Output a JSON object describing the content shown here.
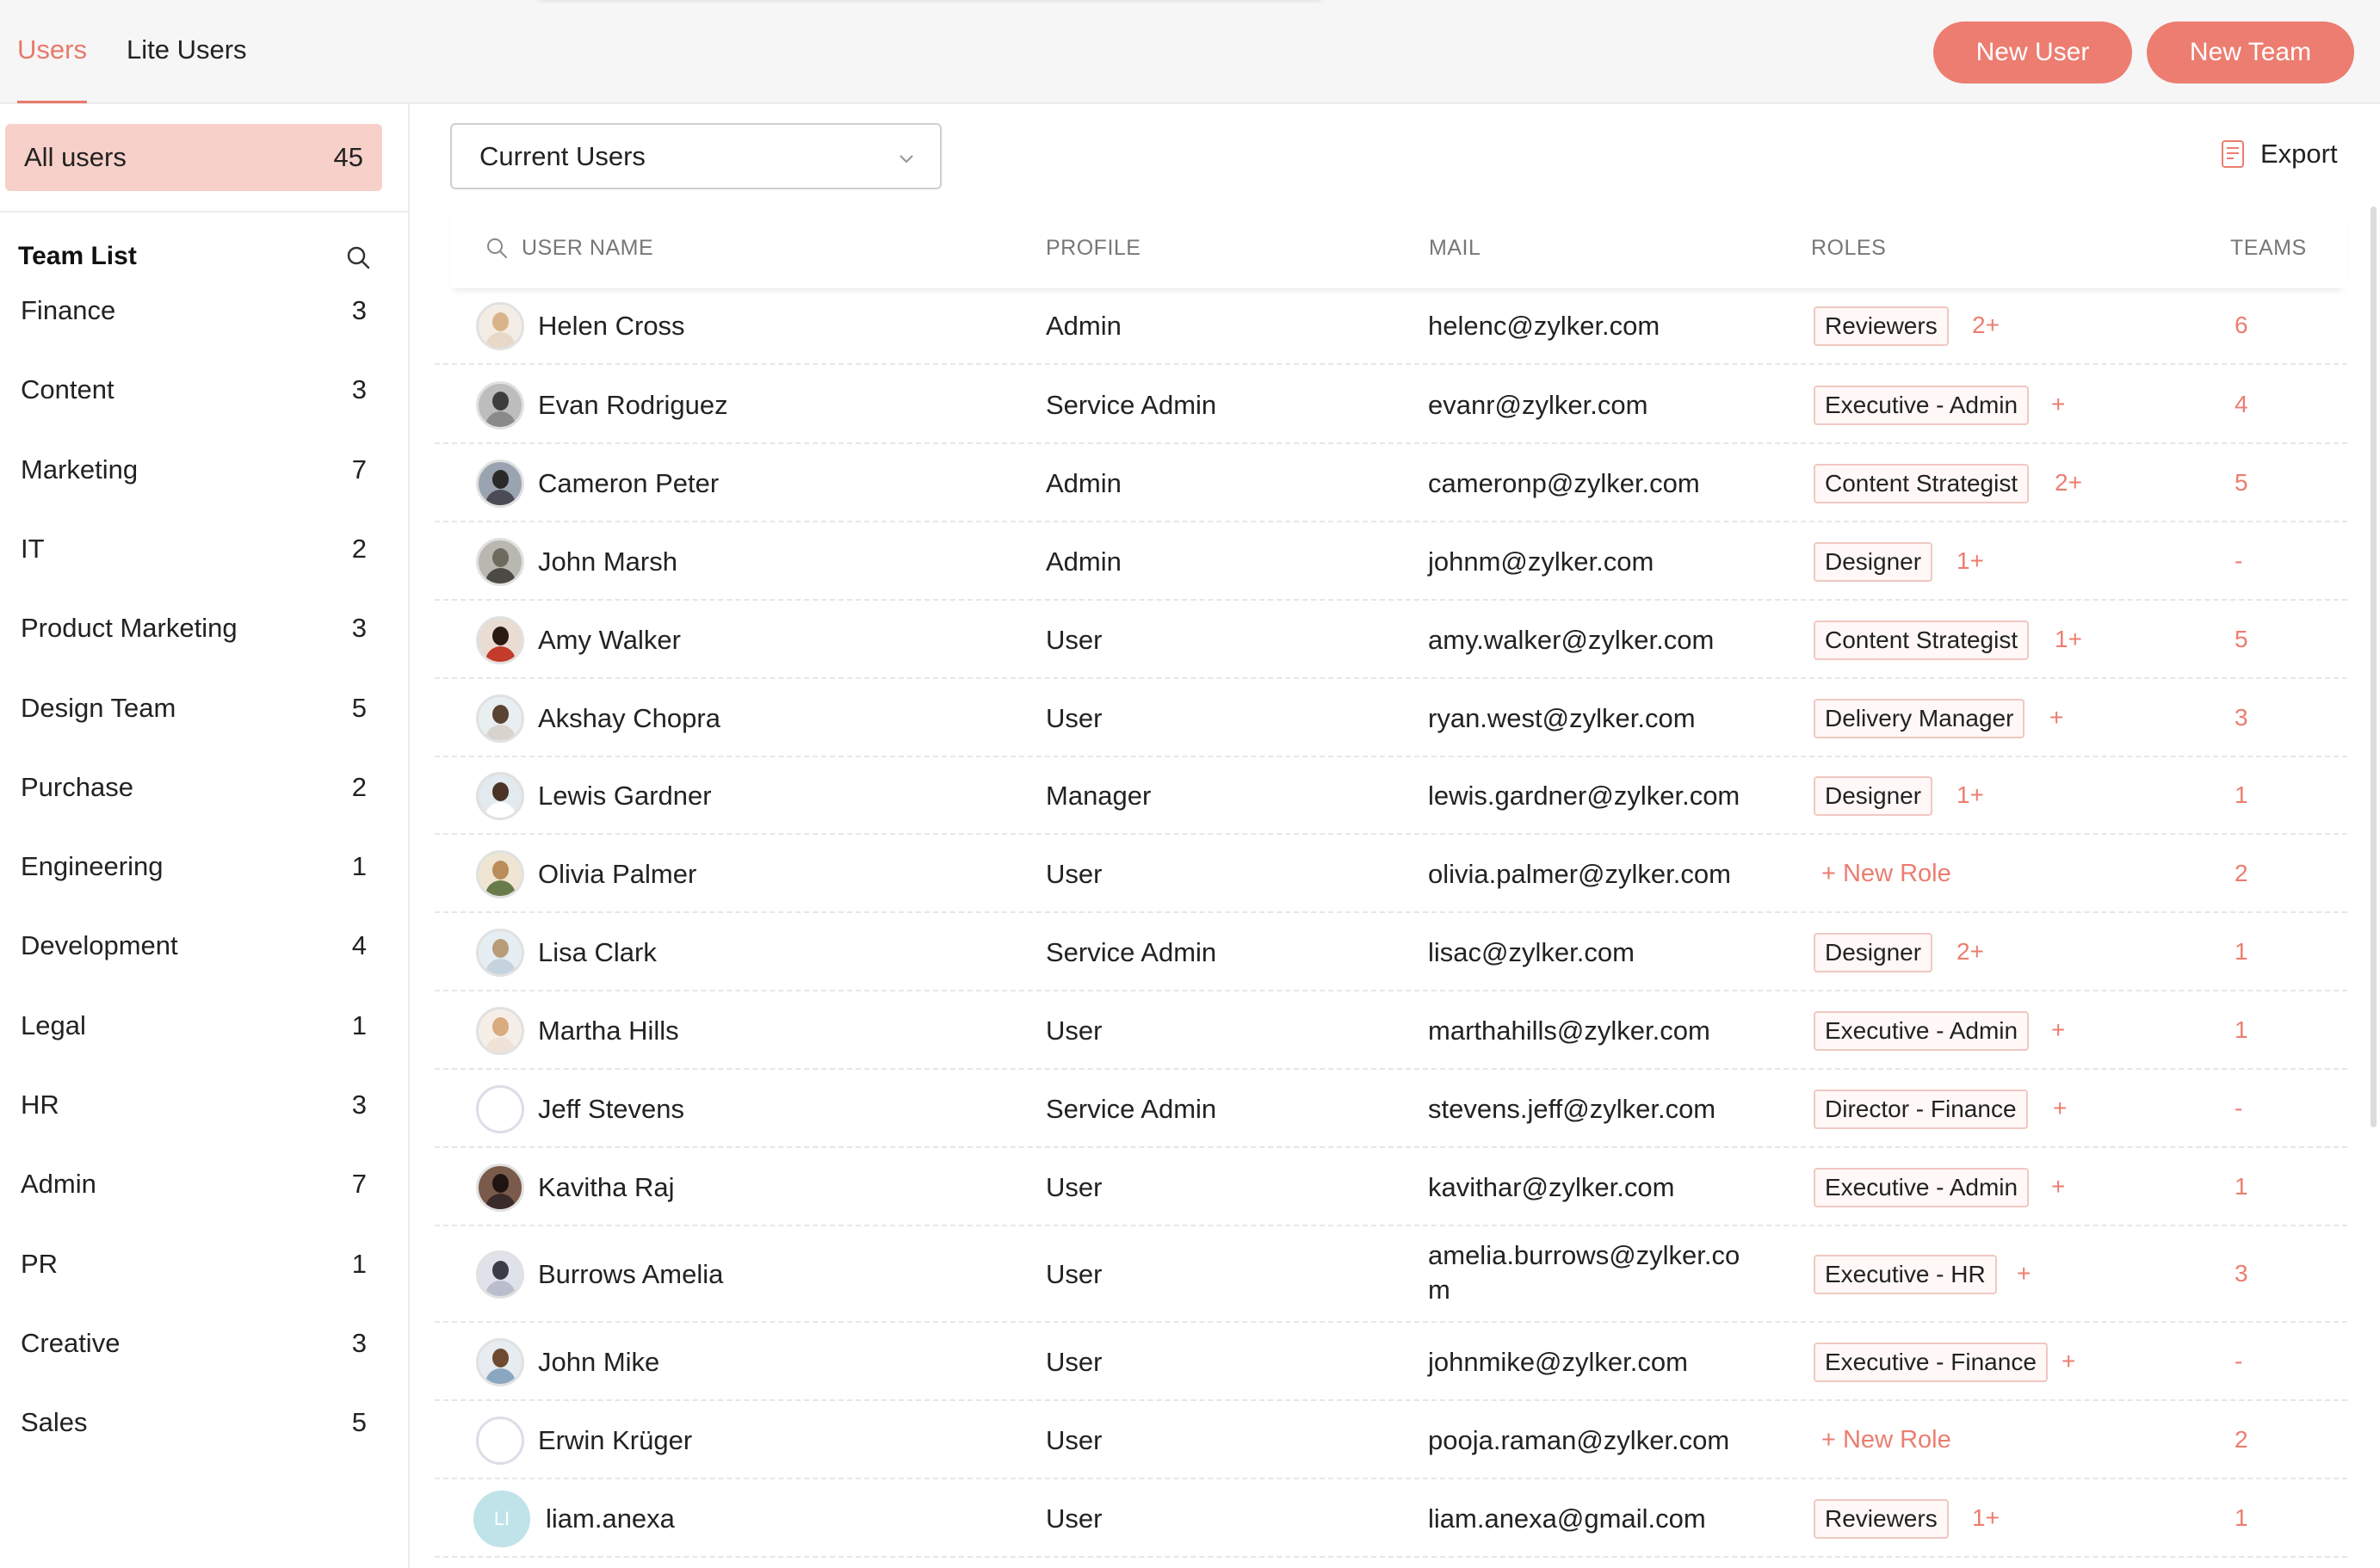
{
  "header": {
    "tabs": [
      {
        "label": "Users",
        "active": true
      },
      {
        "label": "Lite Users",
        "active": false
      }
    ],
    "new_user_label": "New User",
    "new_team_label": "New Team"
  },
  "sidebar": {
    "all_users": {
      "label": "All users",
      "count": "45"
    },
    "team_list_title": "Team List",
    "teams": [
      {
        "label": "Finance",
        "count": "3"
      },
      {
        "label": "Content",
        "count": "3"
      },
      {
        "label": "Marketing",
        "count": "7"
      },
      {
        "label": "IT",
        "count": "2"
      },
      {
        "label": "Product Marketing",
        "count": "3"
      },
      {
        "label": "Design Team",
        "count": "5"
      },
      {
        "label": "Purchase",
        "count": "2"
      },
      {
        "label": "Engineering",
        "count": "1"
      },
      {
        "label": "Development",
        "count": "4"
      },
      {
        "label": "Legal",
        "count": "1"
      },
      {
        "label": "HR",
        "count": "3"
      },
      {
        "label": "Admin",
        "count": "7"
      },
      {
        "label": "PR",
        "count": "1"
      },
      {
        "label": "Creative",
        "count": "3"
      },
      {
        "label": "Sales",
        "count": "5"
      }
    ]
  },
  "filter": {
    "selected": "Current Users"
  },
  "export_label": "Export",
  "table": {
    "columns": [
      "USER NAME",
      "PROFILE",
      "MAIL",
      "ROLES",
      "TEAMS"
    ],
    "rows": [
      {
        "name": "Helen Cross",
        "profile": "Admin",
        "mail": "helenc@zylker.com",
        "role": "Reviewers",
        "role_more": "2+",
        "teams": "6"
      },
      {
        "name": "Evan Rodriguez",
        "profile": "Service Admin",
        "mail": "evanr@zylker.com",
        "role": "Executive - Admin",
        "role_more": "+",
        "teams": "4"
      },
      {
        "name": "Cameron Peter",
        "profile": "Admin",
        "mail": "cameronp@zylker.com",
        "role": "Content Strategist",
        "role_more": "2+",
        "teams": "5"
      },
      {
        "name": "John Marsh",
        "profile": "Admin",
        "mail": "johnm@zylker.com",
        "role": "Designer",
        "role_more": "1+",
        "teams": "-"
      },
      {
        "name": "Amy Walker",
        "profile": "User",
        "mail": "amy.walker@zylker.com",
        "role": "Content Strategist",
        "role_more": "1+",
        "teams": "5"
      },
      {
        "name": "Akshay Chopra",
        "profile": "User",
        "mail": "ryan.west@zylker.com",
        "role": "Delivery Manager",
        "role_more": "+",
        "teams": "3"
      },
      {
        "name": "Lewis Gardner",
        "profile": "Manager",
        "mail": "lewis.gardner@zylker.com",
        "role": "Designer",
        "role_more": "1+",
        "teams": "1"
      },
      {
        "name": "Olivia Palmer",
        "profile": "User",
        "mail": "olivia.palmer@zylker.com",
        "new_role": "+ New Role",
        "teams": "2"
      },
      {
        "name": "Lisa Clark",
        "profile": "Service Admin",
        "mail": "lisac@zylker.com",
        "role": "Designer",
        "role_more": "2+",
        "teams": "1"
      },
      {
        "name": "Martha Hills",
        "profile": "User",
        "mail": "marthahills@zylker.com",
        "role": "Executive - Admin",
        "role_more": "+",
        "teams": "1"
      },
      {
        "name": "Jeff Stevens",
        "profile": "Service Admin",
        "mail": "stevens.jeff@zylker.com",
        "role": "Director - Finance",
        "role_more": "+",
        "teams": "-"
      },
      {
        "name": "Kavitha Raj",
        "profile": "User",
        "mail": "kavithar@zylker.com",
        "role": "Executive - Admin",
        "role_more": "+",
        "teams": "1"
      },
      {
        "name": "Burrows Amelia",
        "profile": "User",
        "mail_line1": "amelia.burrows@zylker.co",
        "mail_line2": "m",
        "role": "Executive - HR",
        "role_more": "+",
        "teams": "3"
      },
      {
        "name": "John Mike",
        "profile": "User",
        "mail": "johnmike@zylker.com",
        "role": "Executive - Finance",
        "role_more": "+",
        "teams": "-"
      },
      {
        "name": "Erwin Krüger",
        "profile": "User",
        "mail": "pooja.raman@zylker.com",
        "new_role": "+ New Role",
        "teams": "2"
      },
      {
        "name": "liam.anexa",
        "initials": "LI",
        "profile": "User",
        "mail": "liam.anexa@gmail.com",
        "role": "Reviewers",
        "role_more": "1+",
        "teams": "1"
      }
    ]
  },
  "colors": {
    "accent": "#ec7d70",
    "selected_bg": "#f7d0c9",
    "chip_border": "#f0c8c2"
  }
}
